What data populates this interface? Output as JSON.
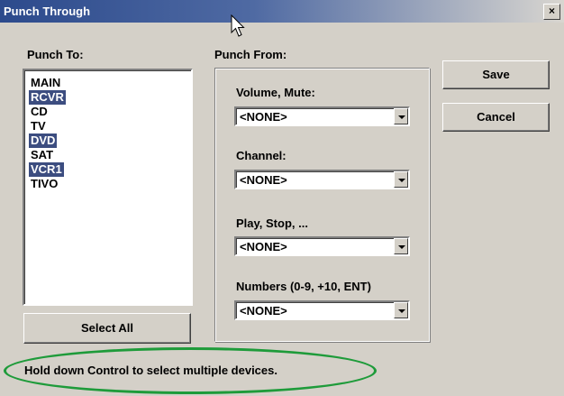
{
  "window": {
    "title": "Punch Through",
    "close_label": "×"
  },
  "punch_to": {
    "label": "Punch To:",
    "items": [
      {
        "label": "MAIN",
        "selected": false
      },
      {
        "label": "RCVR",
        "selected": true
      },
      {
        "label": "CD",
        "selected": false
      },
      {
        "label": "TV",
        "selected": false
      },
      {
        "label": "DVD",
        "selected": true
      },
      {
        "label": "SAT",
        "selected": false
      },
      {
        "label": "VCR1",
        "selected": true
      },
      {
        "label": "TIVO",
        "selected": false
      }
    ],
    "select_all_label": "Select All"
  },
  "punch_from": {
    "label": "Punch From:",
    "volume_label": "Volume, Mute:",
    "volume_value": "<NONE>",
    "channel_label": "Channel:",
    "channel_value": "<NONE>",
    "play_label": "Play, Stop, ...",
    "play_value": "<NONE>",
    "numbers_label": "Numbers (0-9, +10, ENT)",
    "numbers_value": "<NONE>"
  },
  "buttons": {
    "save_label": "Save",
    "cancel_label": "Cancel"
  },
  "hint_text": "Hold down Control to select multiple devices.",
  "colors": {
    "selection": "#3c4d80",
    "dialog_bg": "#d4d0c8",
    "annotation": "#1e9b3a"
  }
}
